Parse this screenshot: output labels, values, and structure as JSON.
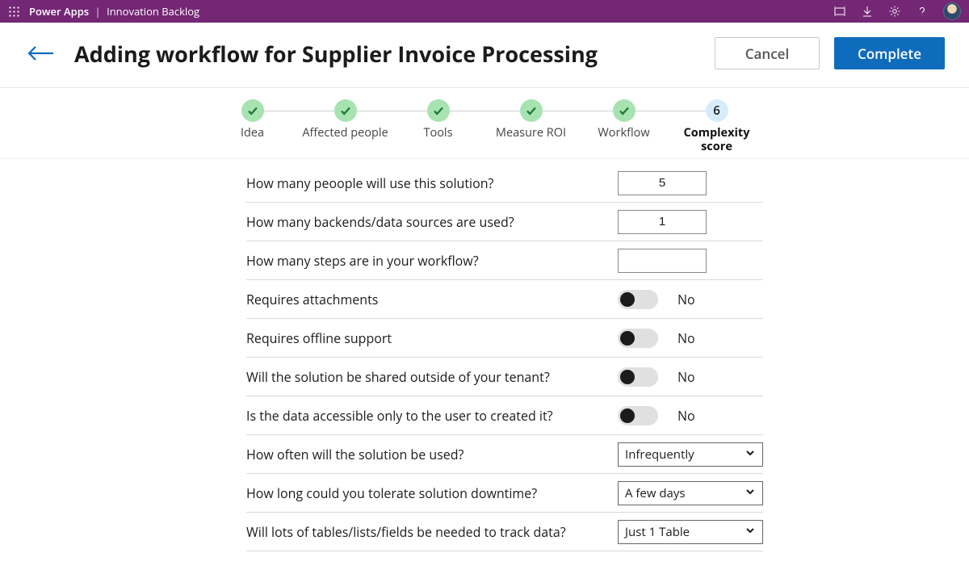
{
  "topbar": {
    "app": "Power Apps",
    "page": "Innovation Backlog"
  },
  "header": {
    "title": "Adding workflow for Supplier Invoice Processing",
    "cancel": "Cancel",
    "complete": "Complete"
  },
  "stepper": {
    "steps": [
      {
        "label": "Idea",
        "state": "done"
      },
      {
        "label": "Affected people",
        "state": "done"
      },
      {
        "label": "Tools",
        "state": "done"
      },
      {
        "label": "Measure ROI",
        "state": "done"
      },
      {
        "label": "Workflow",
        "state": "done"
      },
      {
        "label": "Complexity score",
        "state": "current",
        "number": "6"
      }
    ]
  },
  "form": {
    "q_users": "How many peoople will use this solution?",
    "v_users": "5",
    "q_backends": "How many backends/data sources are  used?",
    "v_backends": "1",
    "q_steps": "How many steps are in your workflow?",
    "v_steps": "",
    "q_attach": "Requires attachments",
    "v_attach": "No",
    "q_offline": "Requires offline support",
    "v_offline": "No",
    "q_shared": "Will the solution be shared  outside of your tenant?",
    "v_shared": "No",
    "q_private": "Is the data accessible only to the user to created it?",
    "v_private": "No",
    "q_freq": "How often will the solution be used?",
    "v_freq": "Infrequently",
    "q_downtime": "How long could you tolerate solution downtime?",
    "v_downtime": "A few days",
    "q_tables": "Will lots of tables/lists/fields be needed to track data?",
    "v_tables": "Just 1 Table"
  }
}
